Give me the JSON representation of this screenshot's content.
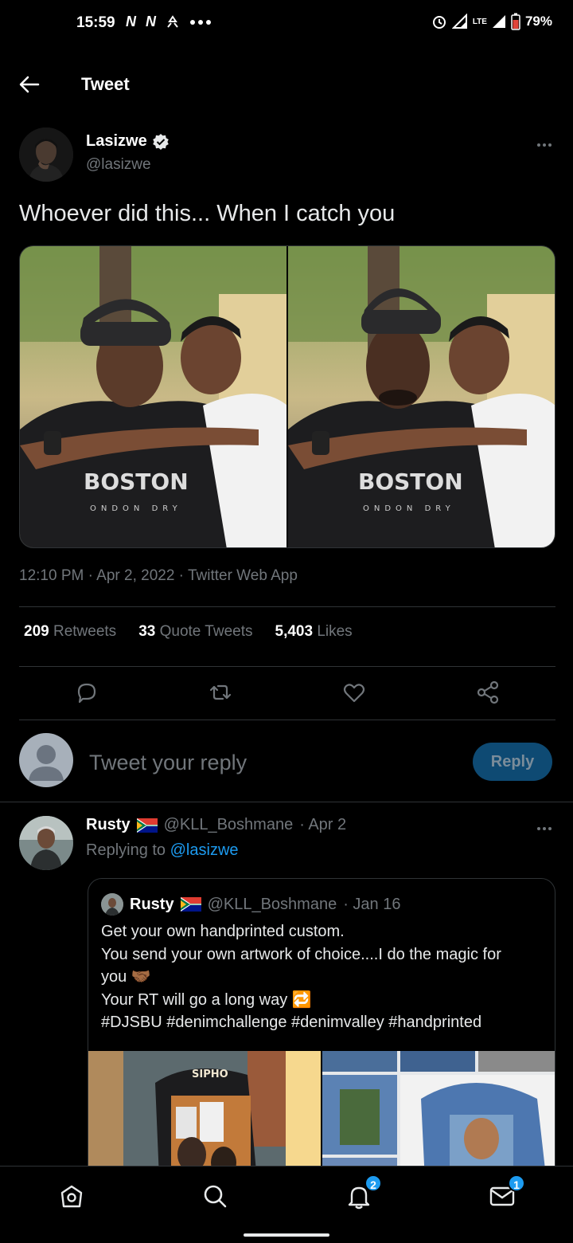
{
  "status_bar": {
    "time": "15:59",
    "left_icons": [
      "N",
      "N"
    ],
    "battery": "79%",
    "network": "LTE"
  },
  "header": {
    "title": "Tweet"
  },
  "tweet": {
    "author_name": "Lasizwe",
    "author_handle": "@lasizwe",
    "text": "Whoever did this... When I catch you",
    "timestamp": "12:10 PM · Apr 2, 2022 · Twitter Web App",
    "stats": [
      {
        "count": "209",
        "label": "Retweets"
      },
      {
        "count": "33",
        "label": "Quote Tweets"
      },
      {
        "count": "5,403",
        "label": "Likes"
      }
    ],
    "image_texts": [
      "BOSTON",
      "ONDON DRY"
    ]
  },
  "reply_composer": {
    "placeholder": "Tweet your reply",
    "button_label": "Reply"
  },
  "reply": {
    "name": "Rusty",
    "handle": "@KLL_Boshmane",
    "date": "· Apr 2",
    "replying_prefix": "Replying to",
    "replying_to": "@lasizwe",
    "quote": {
      "name": "Rusty",
      "handle": "@KLL_Boshmane",
      "date": "· Jan 16",
      "lines": [
        "Get your own handprinted custom.",
        "You send your own artwork of  choice....I do the magic for",
        "you 🤝🏾",
        "Your RT will go a long way 🔁",
        "#DJSBU #denimchallenge #denimvalley #handprinted"
      ],
      "image_text": "SIPHO"
    }
  },
  "bottom_nav": {
    "notifications_badge": "2",
    "messages_badge": "1"
  },
  "colors": {
    "background": "#000000",
    "accent": "#1d9bf0",
    "muted": "#71767b",
    "border": "#2f3336"
  }
}
